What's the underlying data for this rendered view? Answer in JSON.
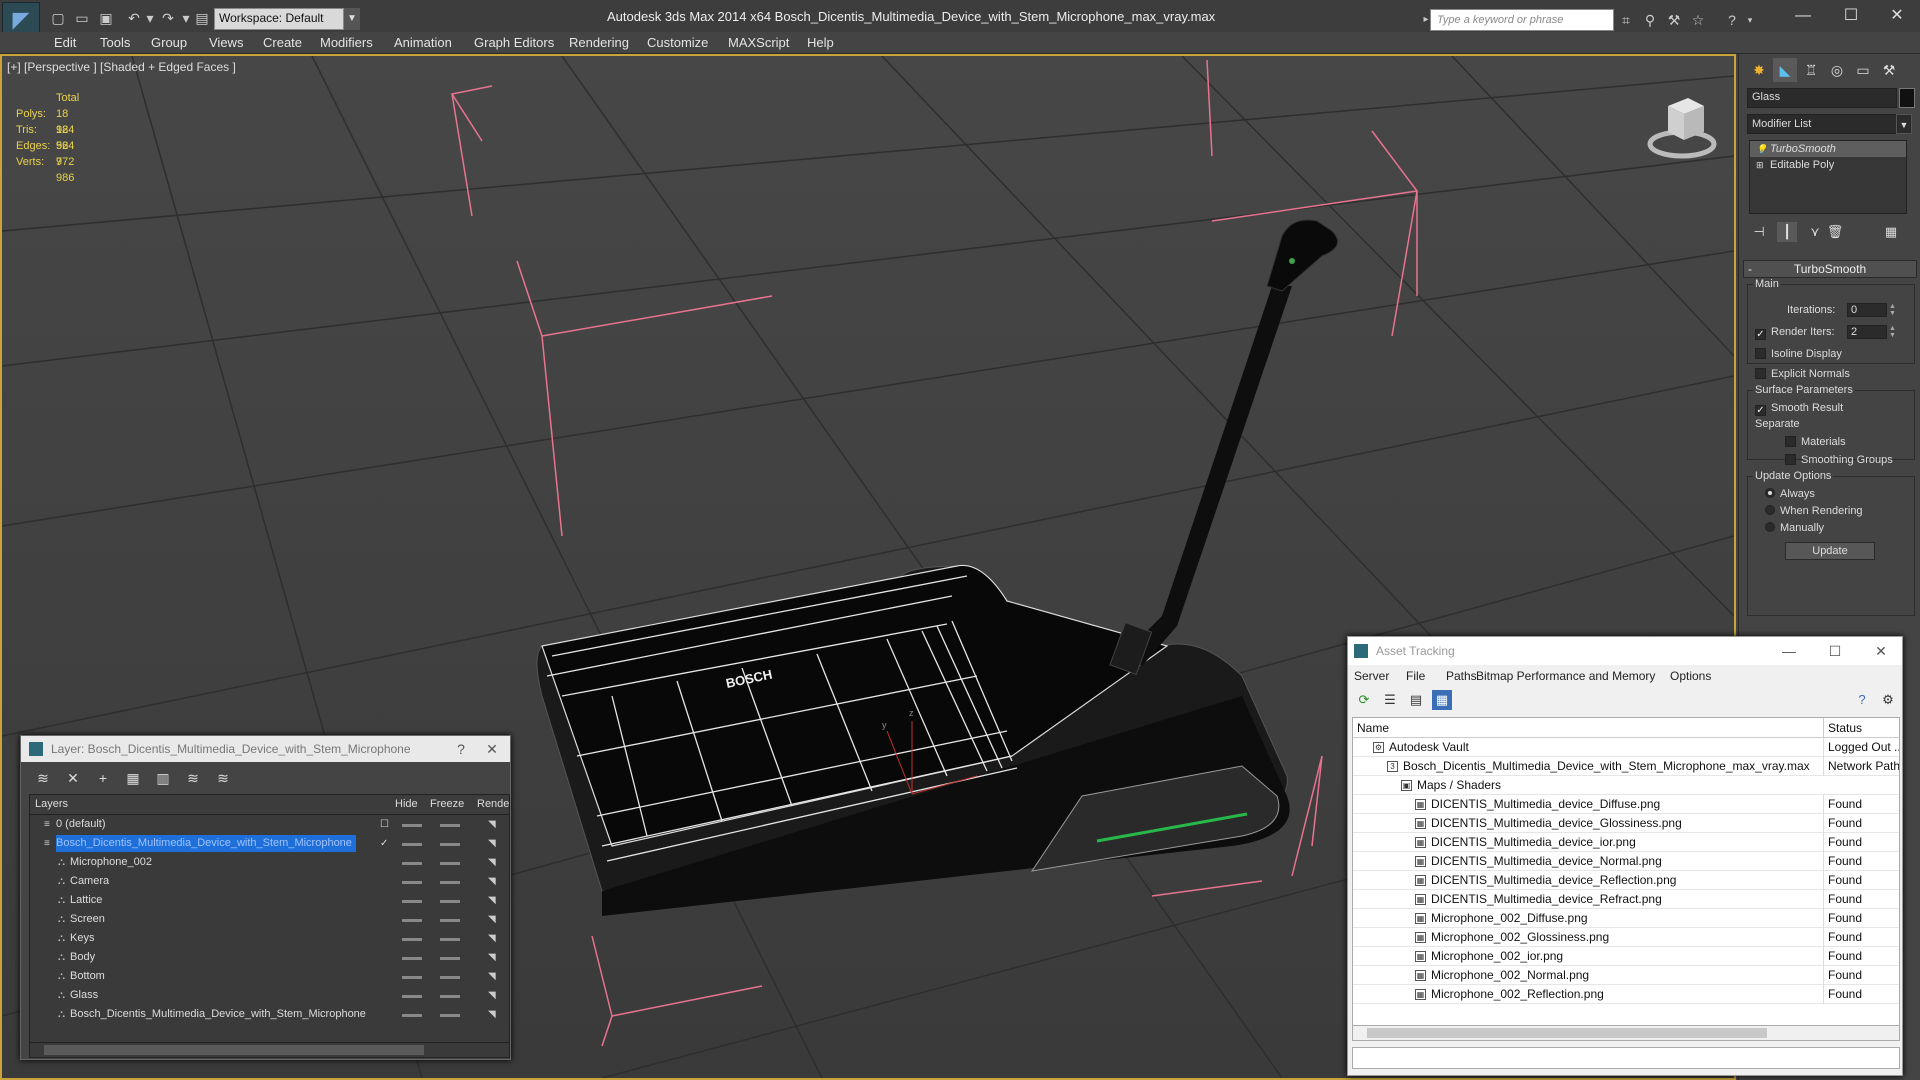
{
  "app": {
    "title": "Autodesk 3ds Max  2014 x64      Bosch_Dicentis_Multimedia_Device_with_Stem_Microphone_max_vray.max",
    "workspace": "Workspace: Default",
    "search_placeholder": "Type a keyword or phrase"
  },
  "menu": [
    "Edit",
    "Tools",
    "Group",
    "Views",
    "Create",
    "Modifiers",
    "Animation",
    "Graph Editors",
    "Rendering",
    "Customize",
    "MAXScript",
    "Help"
  ],
  "viewport": {
    "label": "[+] [Perspective ] [Shaded + Edged Faces ]",
    "stats": {
      "header": "Total",
      "rows": [
        {
          "label": "Polys:",
          "value": "18 924"
        },
        {
          "label": "Tris:",
          "value": "18 924"
        },
        {
          "label": "Edges:",
          "value": "56 772"
        },
        {
          "label": "Verts:",
          "value": "9 986"
        }
      ]
    },
    "brand": "BOSCH"
  },
  "command_panel": {
    "object_name": "Glass",
    "modifier_list": "Modifier List",
    "stack": [
      "TurboSmooth",
      "Editable Poly"
    ],
    "rollout_title": "TurboSmooth",
    "main_group": "Main",
    "iterations_label": "Iterations:",
    "iterations_value": "0",
    "render_iters_label": "Render Iters:",
    "render_iters_value": "2",
    "isoline": "Isoline Display",
    "explicit": "Explicit Normals",
    "surface_group": "Surface Parameters",
    "smooth_result": "Smooth Result",
    "separate": "Separate",
    "materials": "Materials",
    "smoothing_groups": "Smoothing Groups",
    "update_group": "Update Options",
    "always": "Always",
    "when_rendering": "When Rendering",
    "manually": "Manually",
    "update_btn": "Update"
  },
  "layer_window": {
    "title": "Layer: Bosch_Dicentis_Multimedia_Device_with_Stem_Microphone",
    "help": "?",
    "close": "✕",
    "columns": {
      "layers": "Layers",
      "hide": "Hide",
      "freeze": "Freeze",
      "render": "Render"
    },
    "rows": [
      {
        "name": "0 (default)",
        "indent": 0,
        "type": "layer"
      },
      {
        "name": "Bosch_Dicentis_Multimedia_Device_with_Stem_Microphone",
        "indent": 0,
        "type": "layer"
      },
      {
        "name": "Microphone_002",
        "indent": 1,
        "type": "object"
      },
      {
        "name": "Camera",
        "indent": 1,
        "type": "object"
      },
      {
        "name": "Lattice",
        "indent": 1,
        "type": "object"
      },
      {
        "name": "Screen",
        "indent": 1,
        "type": "object"
      },
      {
        "name": "Keys",
        "indent": 1,
        "type": "object"
      },
      {
        "name": "Body",
        "indent": 1,
        "type": "object"
      },
      {
        "name": "Bottom",
        "indent": 1,
        "type": "object"
      },
      {
        "name": "Glass",
        "indent": 1,
        "type": "object"
      },
      {
        "name": "Bosch_Dicentis_Multimedia_Device_with_Stem_Microphone",
        "indent": 1,
        "type": "object"
      }
    ]
  },
  "asset_window": {
    "title": "Asset Tracking",
    "menu": [
      "Server",
      "File",
      "Paths",
      "Bitmap Performance and Memory",
      "Options"
    ],
    "columns": {
      "name": "Name",
      "status": "Status"
    },
    "rows": [
      {
        "name": "Autodesk Vault",
        "status": "Logged Out ...",
        "indent": 1
      },
      {
        "name": "Bosch_Dicentis_Multimedia_Device_with_Stem_Microphone_max_vray.max",
        "status": "Network Path",
        "indent": 2
      },
      {
        "name": "Maps / Shaders",
        "status": "",
        "indent": 3
      },
      {
        "name": "DICENTIS_Multimedia_device_Diffuse.png",
        "status": "Found",
        "indent": 4
      },
      {
        "name": "DICENTIS_Multimedia_device_Glossiness.png",
        "status": "Found",
        "indent": 4
      },
      {
        "name": "DICENTIS_Multimedia_device_ior.png",
        "status": "Found",
        "indent": 4
      },
      {
        "name": "DICENTIS_Multimedia_device_Normal.png",
        "status": "Found",
        "indent": 4
      },
      {
        "name": "DICENTIS_Multimedia_device_Reflection.png",
        "status": "Found",
        "indent": 4
      },
      {
        "name": "DICENTIS_Multimedia_device_Refract.png",
        "status": "Found",
        "indent": 4
      },
      {
        "name": "Microphone_002_Diffuse.png",
        "status": "Found",
        "indent": 4
      },
      {
        "name": "Microphone_002_Glossiness.png",
        "status": "Found",
        "indent": 4
      },
      {
        "name": "Microphone_002_ior.png",
        "status": "Found",
        "indent": 4
      },
      {
        "name": "Microphone_002_Normal.png",
        "status": "Found",
        "indent": 4
      },
      {
        "name": "Microphone_002_Reflection.png",
        "status": "Found",
        "indent": 4
      }
    ]
  }
}
